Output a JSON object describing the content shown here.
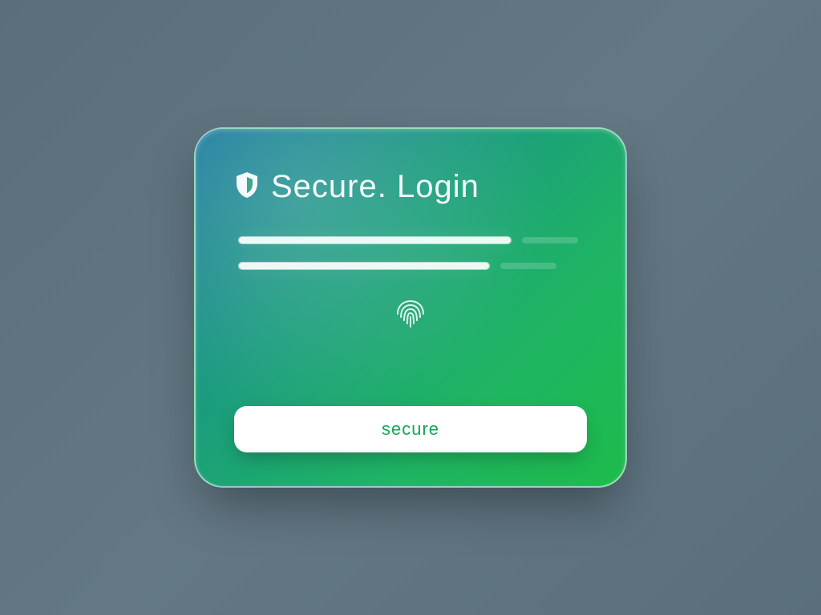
{
  "card": {
    "title": "Secure. Login",
    "fields": {
      "username_value": "",
      "password_value": ""
    },
    "button_label": "secure"
  },
  "icons": {
    "header": "shield-icon",
    "biometric": "fingerprint-icon"
  }
}
